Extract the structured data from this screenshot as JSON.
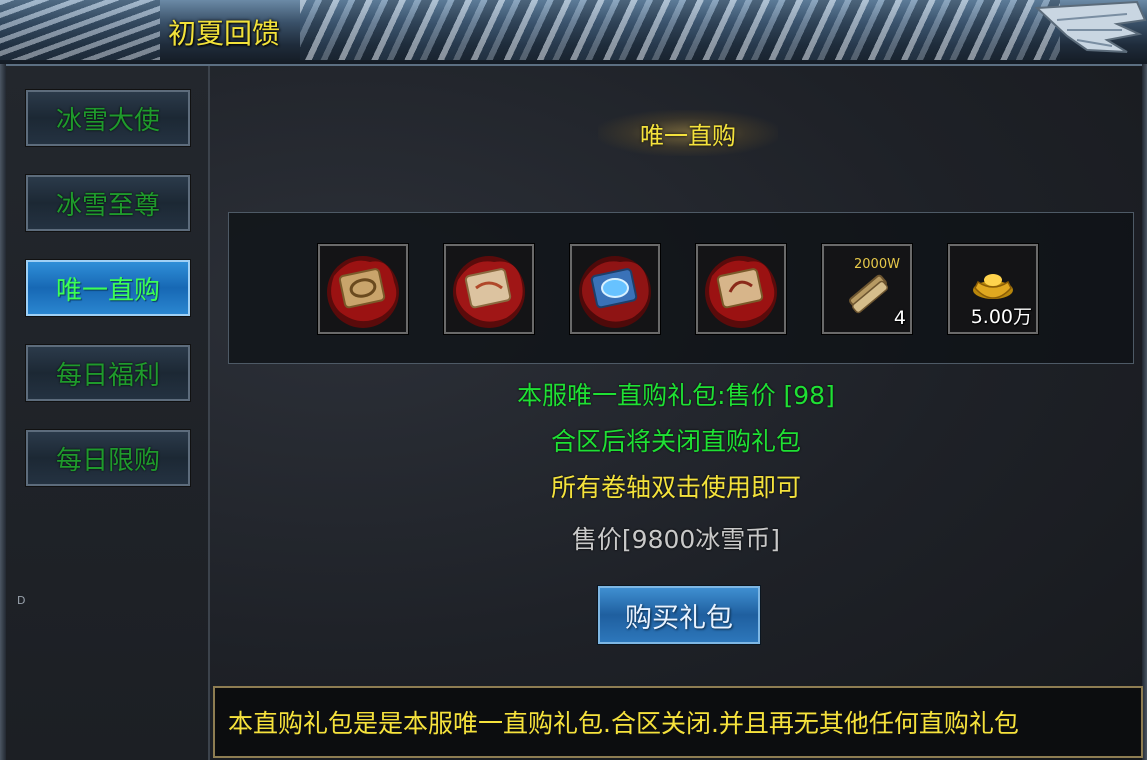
{
  "window": {
    "title": "初夏回馈"
  },
  "sidebar": {
    "tabs": [
      {
        "label": "冰雪大使",
        "active": false
      },
      {
        "label": "冰雪至尊",
        "active": false
      },
      {
        "label": "唯一直购",
        "active": true
      },
      {
        "label": "每日福利",
        "active": false
      },
      {
        "label": "每日限购",
        "active": false
      }
    ],
    "marker": "D"
  },
  "main": {
    "section_title": "唯一直购",
    "items": [
      {
        "icon": "red-scroll-card-icon",
        "qty": ""
      },
      {
        "icon": "red-scroll-card-icon",
        "qty": ""
      },
      {
        "icon": "blue-gem-card-icon",
        "qty": ""
      },
      {
        "icon": "red-scroll-card-icon",
        "qty": ""
      },
      {
        "icon": "exp-scroll-icon",
        "icon_text": "2000W",
        "qty": "4"
      },
      {
        "icon": "gold-ingot-icon",
        "qty": "5.00万"
      }
    ],
    "info_lines": [
      {
        "text": "本服唯一直购礼包:售价 [98]",
        "color": "#1fe034"
      },
      {
        "text": "合区后将关闭直购礼包",
        "color": "#1fe034"
      },
      {
        "text": "所有卷轴双击使用即可",
        "color": "#f4e23c"
      },
      {
        "text": "售价[9800冰雪币]",
        "color": "#c9c9c9"
      }
    ],
    "buy_button": "购买礼包",
    "notice": "本直购礼包是是本服唯一直购礼包.合区关闭.并且再无其他任何直购礼包"
  }
}
